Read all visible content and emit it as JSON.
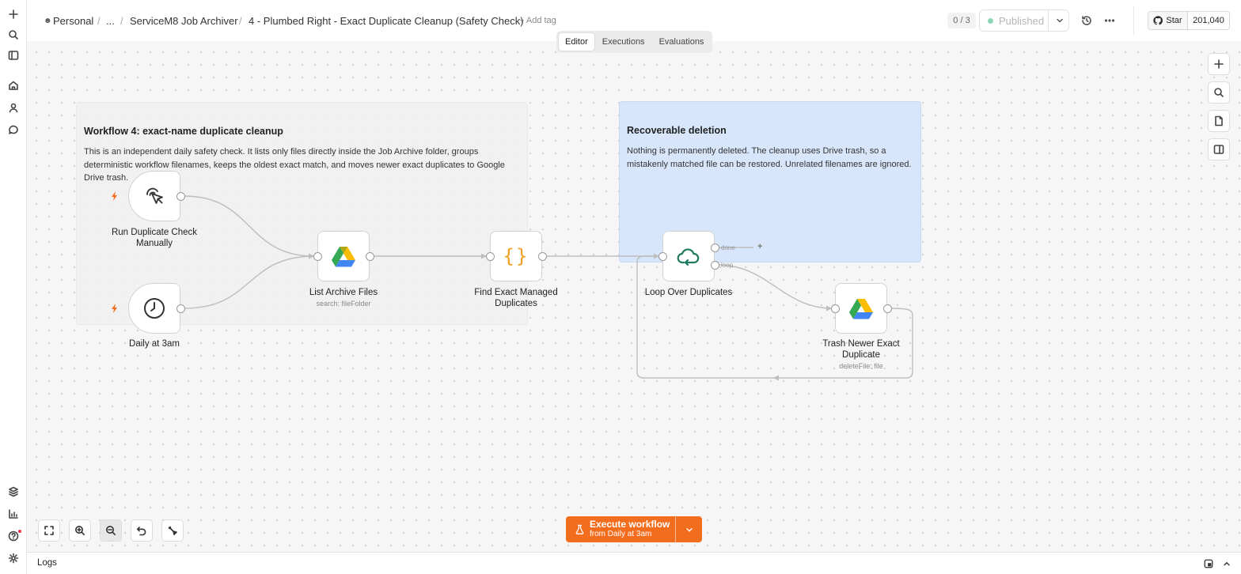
{
  "breadcrumb": {
    "personal": "Personal",
    "ellipsis": "...",
    "folder": "ServiceM8 Job Archiver",
    "workflow": "4 - Plumbed Right - Exact Duplicate Cleanup (Safety Check)",
    "add_tag": "+ Add tag"
  },
  "header": {
    "counter": "0 / 3",
    "published_label": "Published",
    "github_star": "Star",
    "github_count": "201,040"
  },
  "tabs": [
    {
      "label": "Editor",
      "active": true
    },
    {
      "label": "Executions",
      "active": false
    },
    {
      "label": "Evaluations",
      "active": false
    }
  ],
  "stickies": {
    "grey": {
      "title": "Workflow 4: exact-name duplicate cleanup",
      "body": "This is an independent daily safety check. It lists only files directly inside the Job Archive folder, groups deterministic workflow filenames, keeps the oldest exact match, and moves newer exact duplicates to Google Drive trash."
    },
    "blue": {
      "title": "Recoverable deletion",
      "body": "Nothing is permanently deleted. The cleanup uses Drive trash, so a mistakenly matched file can be restored. Unrelated filenames are ignored."
    }
  },
  "nodes": {
    "manual": {
      "label": "Run Duplicate Check Manually",
      "icon": "cursor-click-icon"
    },
    "daily": {
      "label": "Daily at 3am",
      "icon": "clock-icon"
    },
    "list": {
      "label": "List Archive Files",
      "sub": "search: fileFolder",
      "icon": "google-drive-icon"
    },
    "find": {
      "label": "Find Exact Managed Duplicates",
      "icon": "code-braces-icon"
    },
    "loop": {
      "label": "Loop Over Duplicates",
      "icon": "loop-icon",
      "done": "done",
      "loop": "loop"
    },
    "trash": {
      "label": "Trash Newer Exact Duplicate",
      "sub": "deleteFile: file",
      "icon": "google-drive-icon"
    }
  },
  "execute": {
    "label": "Execute workflow",
    "sub": "from Daily at 3am"
  },
  "logs": {
    "label": "Logs"
  },
  "colors": {
    "accent": "#f36d1f",
    "sticky_blue": "#d8e6fb",
    "loop_green": "#1f7a5f",
    "code_yellow": "#f0a020"
  }
}
